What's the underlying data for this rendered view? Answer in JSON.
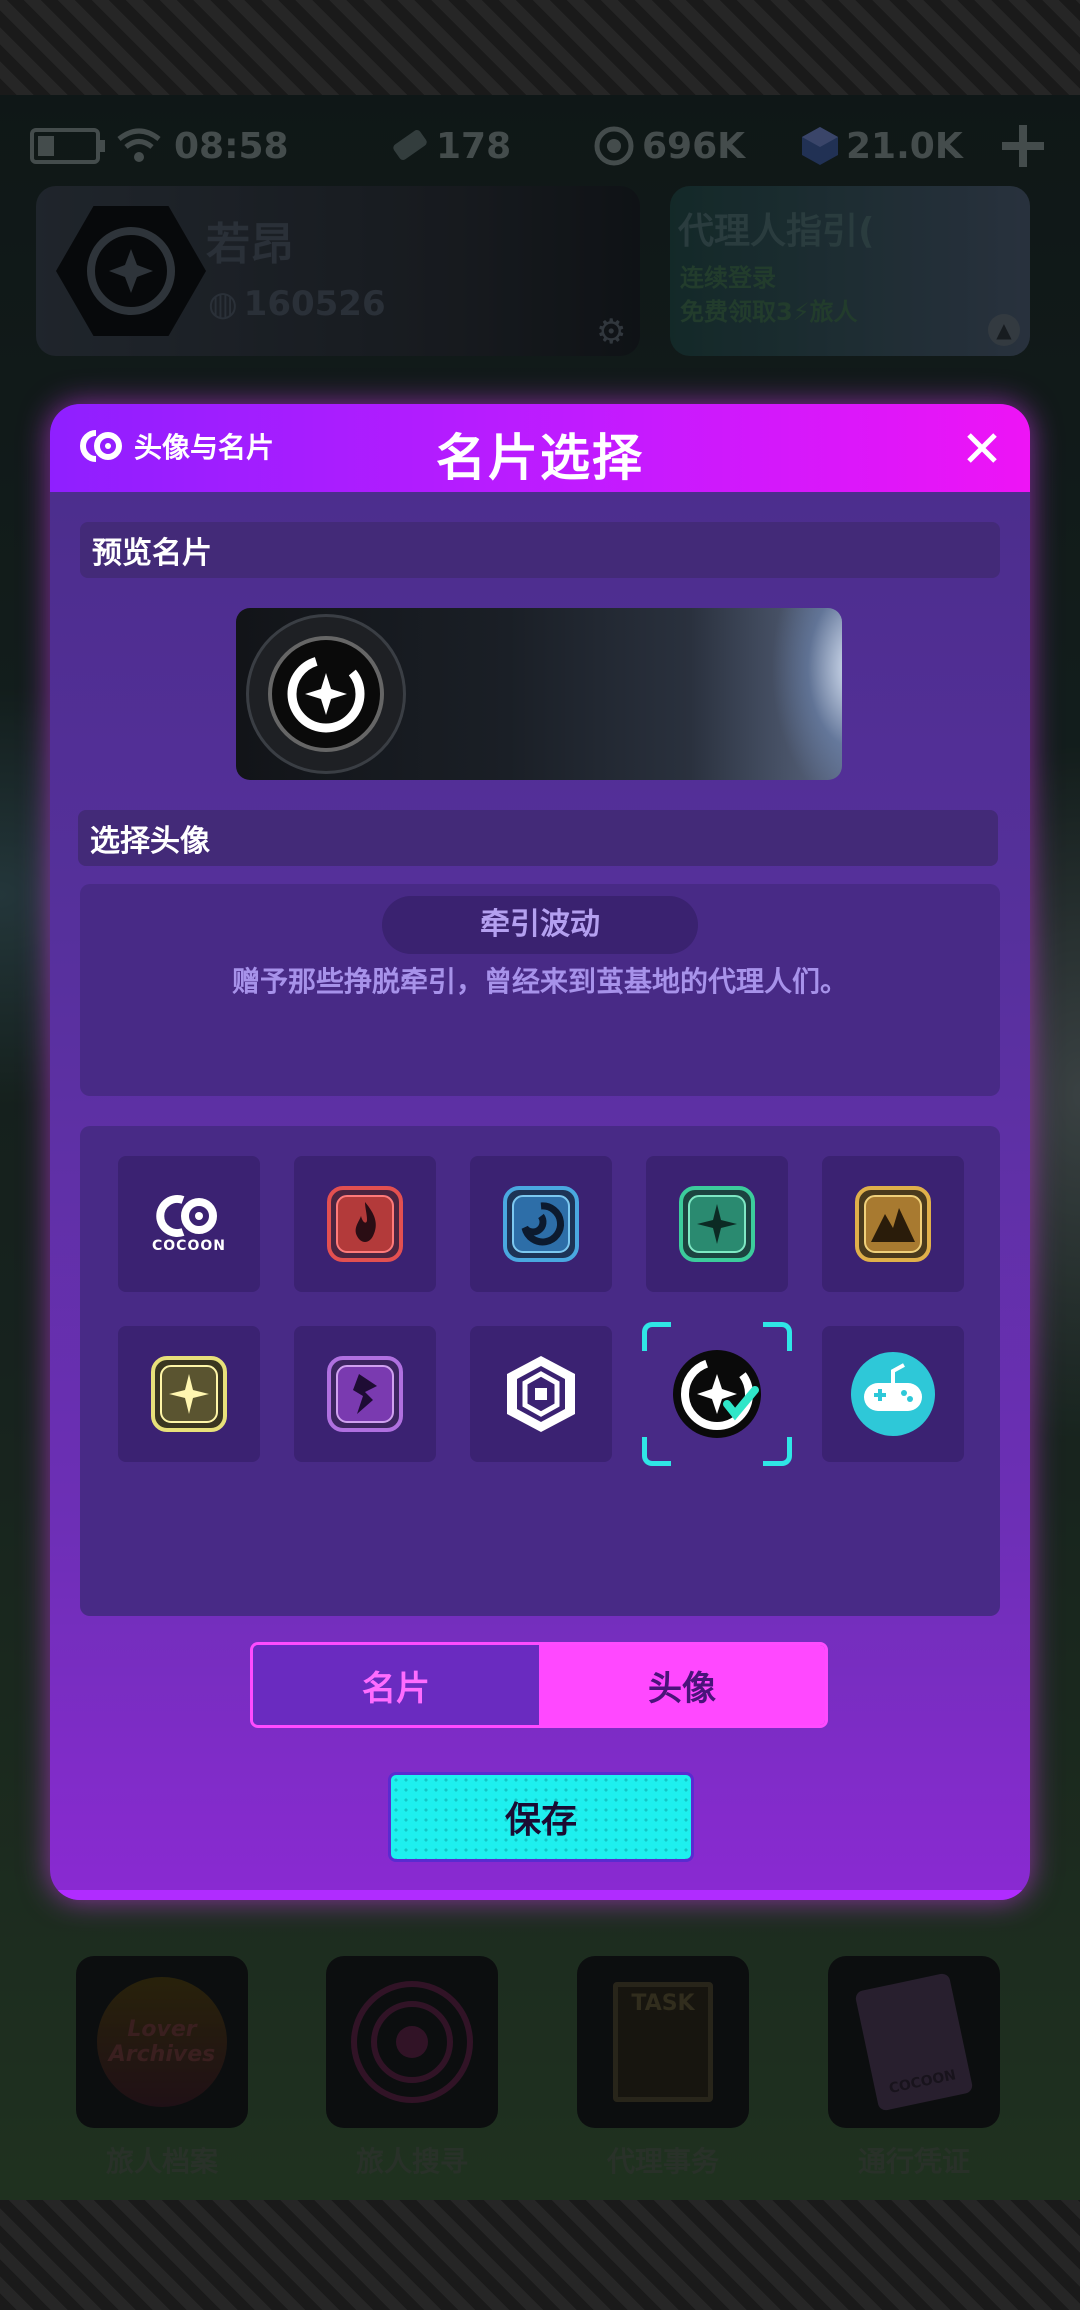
{
  "status_bar": {
    "time": "08:58",
    "stamina": "178",
    "coins": "696K",
    "gems": "21.0K"
  },
  "profile": {
    "name": "若昂",
    "id": "160526"
  },
  "guide": {
    "title": "代理人指引(",
    "line1": "连续登录",
    "line2": "免费领取3",
    "line2_suffix": "旅人"
  },
  "modal": {
    "brand": "头像与名片",
    "title": "名片选择",
    "preview_label": "预览名片",
    "select_label": "选择头像",
    "selected_name": "牵引波动",
    "selected_desc": "赠予那些挣脱牵引，曾经来到茧基地的代理人们。",
    "avatars": [
      {
        "name": "COCOON",
        "text": "COCOON",
        "bg": "#3b2272"
      },
      {
        "name": "red-flame",
        "bg": "#3b2272",
        "color": "#e35050"
      },
      {
        "name": "blue-swirl",
        "bg": "#3b2272",
        "color": "#4aa8e0"
      },
      {
        "name": "green-shuriken",
        "bg": "#3b2272",
        "color": "#3ccc9c"
      },
      {
        "name": "gold-mountain",
        "bg": "#3b2272",
        "color": "#e0b04a"
      },
      {
        "name": "yellow-star",
        "bg": "#3b2272",
        "color": "#e8e07a"
      },
      {
        "name": "violet-blade",
        "bg": "#3b2272",
        "color": "#b070e0"
      },
      {
        "name": "hex-emblem",
        "bg": "#3b2272"
      },
      {
        "name": "traction-wave",
        "bg": "#1a1a1a",
        "selected": true
      },
      {
        "name": "gamepad",
        "bg": "#2ec8d8"
      }
    ],
    "tabs": [
      "名片",
      "头像"
    ],
    "active_tab": "头像",
    "save_label": "保存"
  },
  "bottom_nav": [
    {
      "label": "旅人档案"
    },
    {
      "label": "旅人搜寻"
    },
    {
      "label": "代理事务"
    },
    {
      "label": "通行凭证"
    }
  ],
  "nav_tile_text": {
    "archive_line1": "Lover",
    "archive_line2": "Archives",
    "task": "TASK",
    "cocoon": "COCOON"
  },
  "colors": {
    "accent_magenta": "#ff48ff",
    "accent_cyan": "#1ef0ef",
    "modal_purple": "#56309c"
  }
}
